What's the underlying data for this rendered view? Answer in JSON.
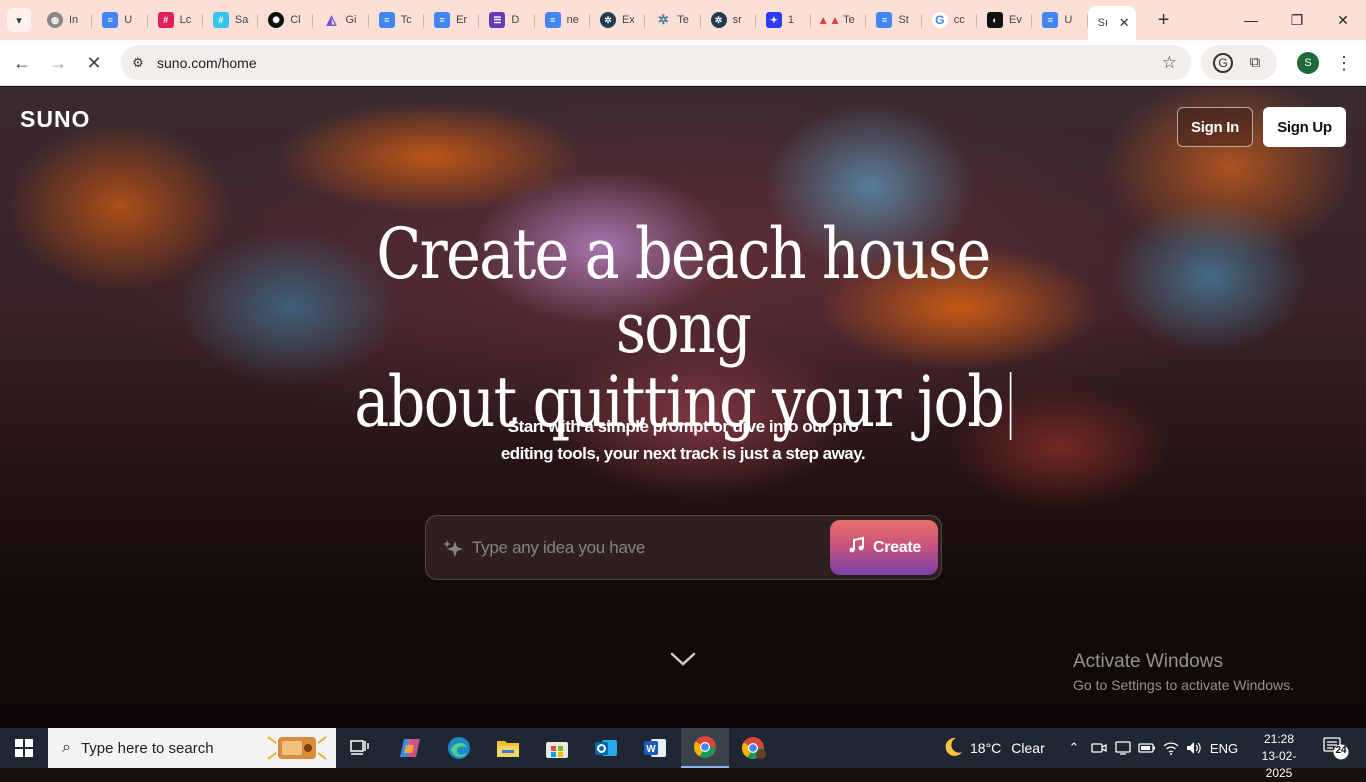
{
  "browser": {
    "tabs": [
      {
        "label": "In",
        "icon": "globe-icon"
      },
      {
        "label": "U",
        "icon": "google-docs-icon"
      },
      {
        "label": "Lc",
        "icon": "slack-icon"
      },
      {
        "label": "Sa",
        "icon": "slack-icon"
      },
      {
        "label": "Cl",
        "icon": "openai-icon"
      },
      {
        "label": "Gi",
        "icon": "gamma-icon"
      },
      {
        "label": "Tc",
        "icon": "google-docs-icon"
      },
      {
        "label": "Er",
        "icon": "google-docs-icon"
      },
      {
        "label": "D",
        "icon": "forms-icon"
      },
      {
        "label": "ne",
        "icon": "google-docs-icon"
      },
      {
        "label": "Ex",
        "icon": "perplexity-icon"
      },
      {
        "label": "Te",
        "icon": "perplexity-icon"
      },
      {
        "label": "sr",
        "icon": "perplexity-icon"
      },
      {
        "label": "1",
        "icon": "ai-icon"
      },
      {
        "label": "Te",
        "icon": "mountain-icon"
      },
      {
        "label": "St",
        "icon": "google-docs-icon"
      },
      {
        "label": "cc",
        "icon": "google-icon"
      },
      {
        "label": "Ev",
        "icon": "eclipse-icon"
      },
      {
        "label": "U",
        "icon": "google-docs-icon"
      },
      {
        "label": "Sı",
        "icon": "suno-icon",
        "active": true
      }
    ],
    "url": "suno.com/home",
    "profile_initial": "S"
  },
  "page": {
    "logo": "SUNO",
    "sign_in": "Sign In",
    "sign_up": "Sign Up",
    "headline_line1": "Create a beach house song",
    "headline_line2": "about quitting your job",
    "subtext_line1": "Start with a simple prompt or dive into our pro",
    "subtext_line2": "editing tools, your next track is just a step away.",
    "prompt_placeholder": "Type any idea you have",
    "create_label": "Create",
    "watermark_title": "Activate Windows",
    "watermark_sub": "Go to Settings to activate Windows."
  },
  "taskbar": {
    "search_placeholder": "Type here to search",
    "weather_temp": "18°C",
    "weather_desc": "Clear",
    "language": "ENG",
    "time": "21:28",
    "date": "13-02-2025",
    "notification_count": "24"
  }
}
